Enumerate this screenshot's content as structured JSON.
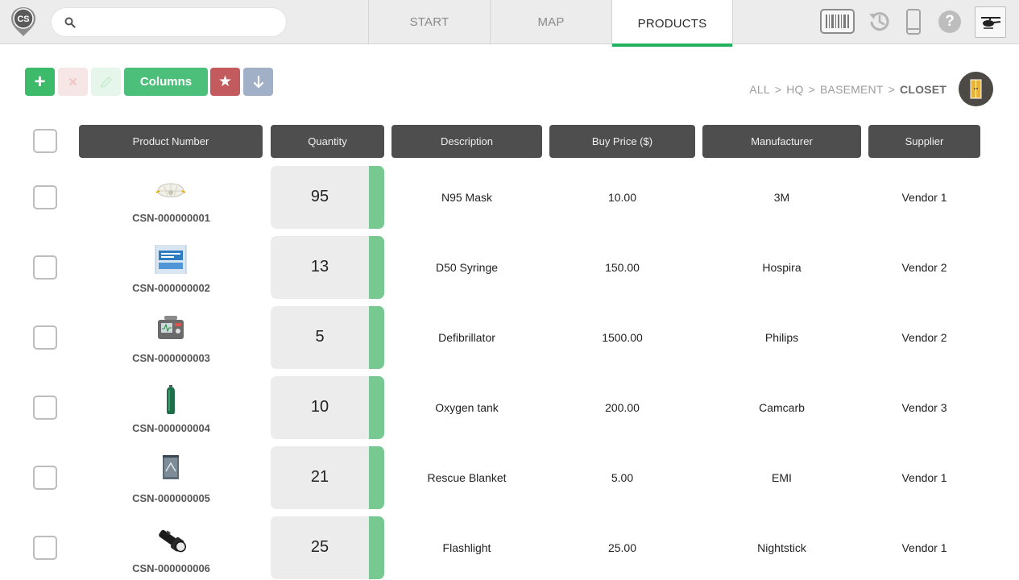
{
  "app": {
    "logo_text": "CS"
  },
  "search": {
    "value": "",
    "placeholder": ""
  },
  "tabs": [
    {
      "label": "START",
      "active": false
    },
    {
      "label": "MAP",
      "active": false
    },
    {
      "label": "PRODUCTS",
      "active": true
    }
  ],
  "topbar_icons": [
    "barcode-icon",
    "history-icon",
    "phone-icon",
    "help-icon",
    "helicopter-icon"
  ],
  "help_glyph": "?",
  "toolbar": {
    "add_icon": "+",
    "delete_icon": "✕",
    "edit_icon": "pencil-icon",
    "columns_label": "Columns",
    "favorite_icon": "★",
    "download_icon": "↓"
  },
  "breadcrumb": {
    "items": [
      "ALL",
      "HQ",
      "BASEMENT"
    ],
    "separator": ">",
    "current": "CLOSET"
  },
  "table": {
    "headers": [
      "Product Number",
      "Quantity",
      "Description",
      "Buy Price ($)",
      "Manufacturer",
      "Supplier"
    ],
    "rows": [
      {
        "product_number": "CSN-000000001",
        "image": "n95-mask-image",
        "quantity": "95",
        "description": "N95 Mask",
        "buy_price": "10.00",
        "manufacturer": "3M",
        "supplier": "Vendor 1"
      },
      {
        "product_number": "CSN-000000002",
        "image": "syringe-package-image",
        "quantity": "13",
        "description": "D50 Syringe",
        "buy_price": "150.00",
        "manufacturer": "Hospira",
        "supplier": "Vendor 2"
      },
      {
        "product_number": "CSN-000000003",
        "image": "defibrillator-image",
        "quantity": "5",
        "description": "Defibrillator",
        "buy_price": "1500.00",
        "manufacturer": "Philips",
        "supplier": "Vendor 2"
      },
      {
        "product_number": "CSN-000000004",
        "image": "oxygen-tank-image",
        "quantity": "10",
        "description": "Oxygen tank",
        "buy_price": "200.00",
        "manufacturer": "Camcarb",
        "supplier": "Vendor 3"
      },
      {
        "product_number": "CSN-000000005",
        "image": "rescue-blanket-image",
        "quantity": "21",
        "description": "Rescue Blanket",
        "buy_price": "5.00",
        "manufacturer": "EMI",
        "supplier": "Vendor 1"
      },
      {
        "product_number": "CSN-000000006",
        "image": "flashlight-image",
        "quantity": "25",
        "description": "Flashlight",
        "buy_price": "25.00",
        "manufacturer": "Nightstick",
        "supplier": "Vendor 1"
      }
    ]
  },
  "colors": {
    "accent_green": "#22b15e",
    "quantity_bar": "#77c891",
    "header_bg": "#4e4e4e",
    "favorite_red": "#c25a5e",
    "download_blue": "#a1b0c6"
  }
}
